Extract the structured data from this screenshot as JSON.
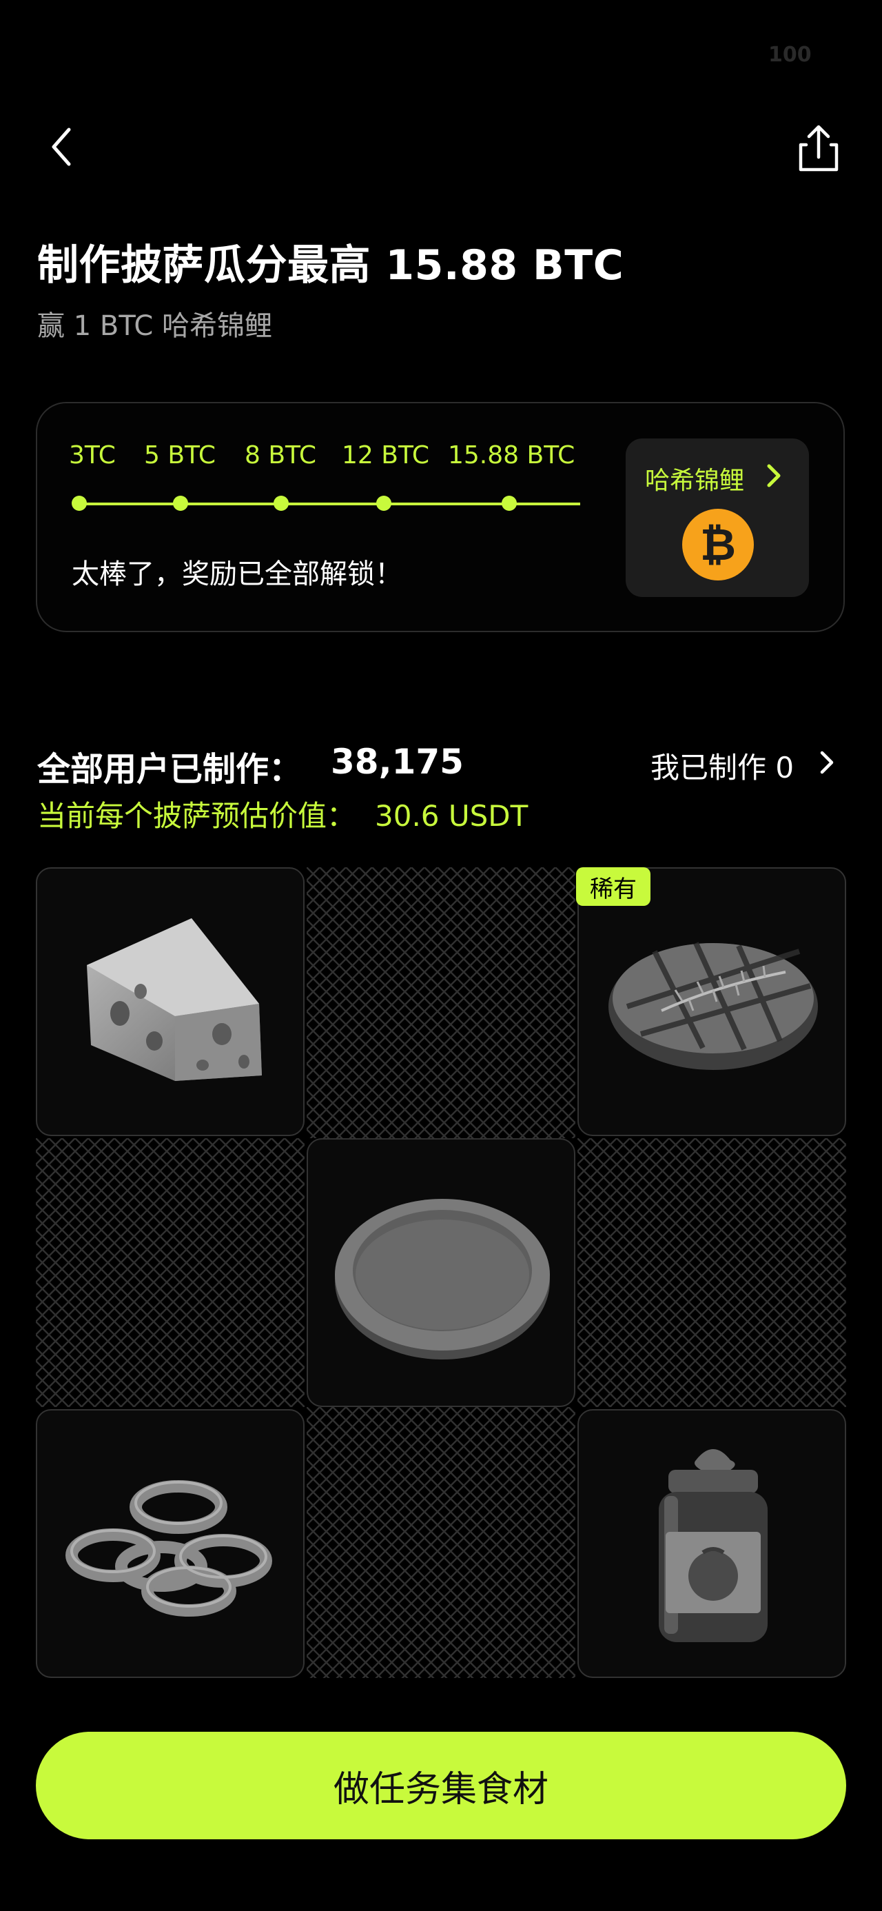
{
  "status_bar": {
    "battery": "100"
  },
  "header": {
    "back_icon": "chevron-left-icon",
    "share_icon": "share-icon"
  },
  "title": "制作披萨瓜分最高 15.88 BTC",
  "subtitle": "赢 1 BTC 哈希锦鲤",
  "progress": {
    "milestones": [
      "3TC",
      "5 BTC",
      "8 BTC",
      "12 BTC",
      "15.88 BTC"
    ],
    "status_text": "太棒了，奖励已全部解锁！",
    "reward_label": "哈希锦鲤",
    "reward_icon": "bitcoin-icon",
    "reward_symbol": "₿"
  },
  "stats": {
    "all_users_label": "全部用户已制作：",
    "all_users_count": "38,175",
    "my_made_label": "我已制作 0",
    "value_label": "当前每个披萨预估价值：",
    "value_amount": "30.6 USDT"
  },
  "ingredients": [
    {
      "name": "cheese",
      "icon": "cheese-icon"
    },
    {
      "name": "steak",
      "icon": "steak-icon",
      "badge": "稀有"
    },
    {
      "name": "pizza-base",
      "icon": "dough-icon"
    },
    {
      "name": "pepper-rings",
      "icon": "pepper-rings-icon"
    },
    {
      "name": "tomato-sauce",
      "icon": "sauce-jar-icon"
    }
  ],
  "cta_label": "做任务集食材",
  "colors": {
    "accent": "#c8fa3c",
    "bitcoin": "#f7a21b",
    "background": "#000000"
  }
}
